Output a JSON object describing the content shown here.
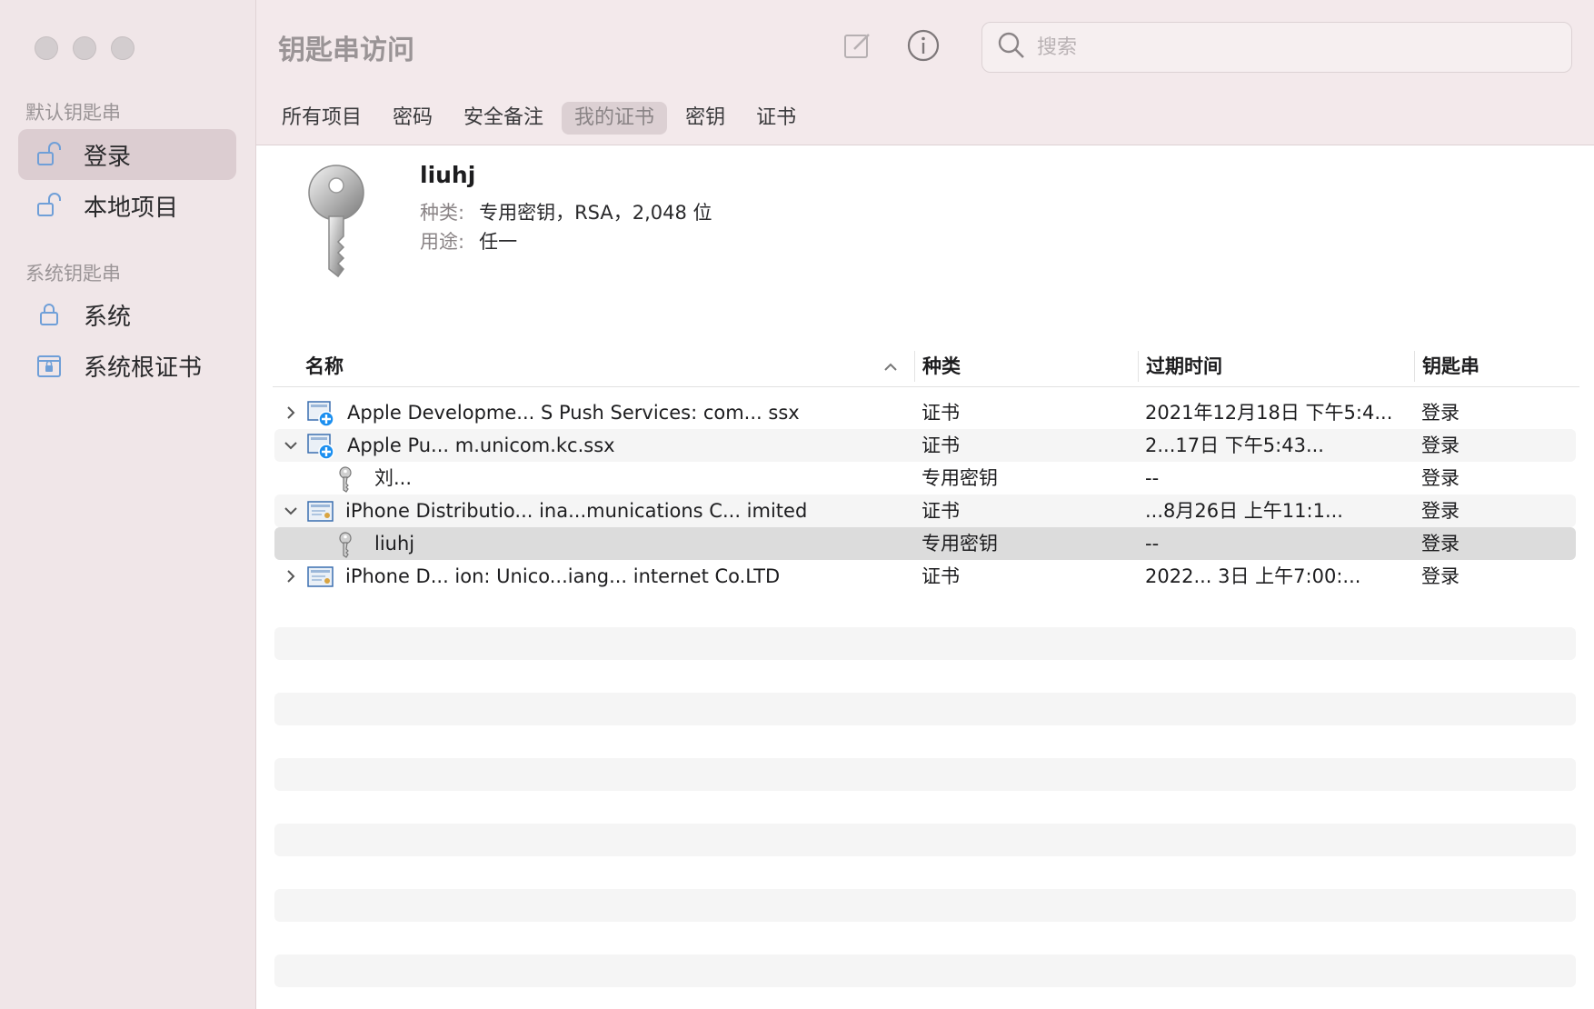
{
  "app": {
    "title": "钥匙串访问"
  },
  "search": {
    "placeholder": "搜索"
  },
  "sidebar": {
    "section_default": "默认钥匙串",
    "section_system": "系统钥匙串",
    "items": [
      {
        "label": "登录",
        "icon": "unlock-icon"
      },
      {
        "label": "本地项目",
        "icon": "unlock-icon"
      },
      {
        "label": "系统",
        "icon": "lock-icon"
      },
      {
        "label": "系统根证书",
        "icon": "locked-cabinet-icon"
      }
    ]
  },
  "tabs": [
    {
      "label": "所有项目"
    },
    {
      "label": "密码"
    },
    {
      "label": "安全备注"
    },
    {
      "label": "我的证书",
      "active": true
    },
    {
      "label": "密钥"
    },
    {
      "label": "证书"
    }
  ],
  "detail": {
    "name": "liuhj",
    "kind_label": "种类:",
    "kind_value": "专用密钥，RSA，2,048 位",
    "usage_label": "用途:",
    "usage_value": "任一"
  },
  "table": {
    "columns": [
      "名称",
      "种类",
      "过期时间",
      "钥匙串"
    ],
    "rows": [
      {
        "name": "Apple Developme... S Push Services: com... ssx",
        "kind": "证书",
        "expires": "2021年12月18日 下午5:4...",
        "keychain": "登录"
      },
      {
        "name": "Apple Pu... m.unicom.kc.ssx",
        "kind": "证书",
        "expires": "2...17日 下午5:43...",
        "keychain": "登录"
      },
      {
        "name": "刘...",
        "kind": "专用密钥",
        "expires": "--",
        "keychain": "登录"
      },
      {
        "name": "iPhone Distributio... ina...munications C... imited",
        "kind": "证书",
        "expires": "...8月26日 上午11:1...",
        "keychain": "登录"
      },
      {
        "name": "liuhj",
        "kind": "专用密钥",
        "expires": "--",
        "keychain": "登录"
      },
      {
        "name": "iPhone D... ion: Unico...iang... internet Co.LTD",
        "kind": "证书",
        "expires": "2022... 3日 上午7:00:...",
        "keychain": "登录"
      }
    ]
  }
}
